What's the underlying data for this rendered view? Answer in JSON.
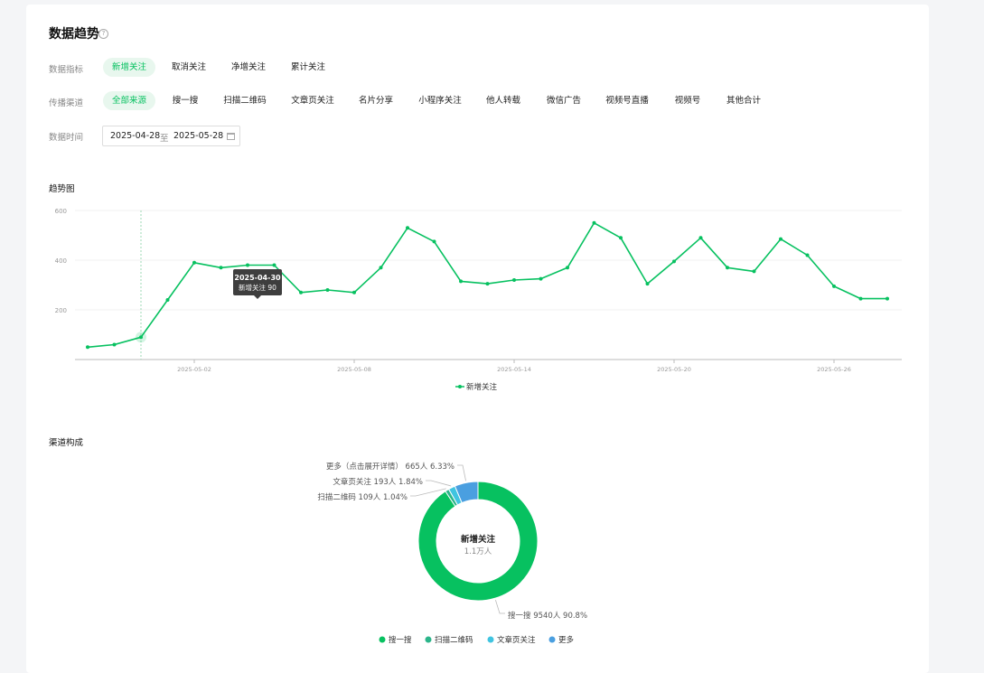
{
  "page": {
    "title": "数据趋势",
    "help_icon": "?"
  },
  "metrics": {
    "label": "数据指标",
    "options": [
      "新增关注",
      "取消关注",
      "净增关注",
      "累计关注"
    ],
    "selected": "新增关注"
  },
  "channels": {
    "label": "传播渠道",
    "options": [
      "全部来源",
      "搜一搜",
      "扫描二维码",
      "文章页关注",
      "名片分享",
      "小程序关注",
      "他人转载",
      "微信广告",
      "视频号直播",
      "视频号",
      "其他合计"
    ],
    "selected": "全部来源"
  },
  "date_range": {
    "label": "数据时间",
    "start": "2025-04-28",
    "separator": "至",
    "end": "2025-05-28"
  },
  "trend_title": "趋势图",
  "composition_title": "渠道构成",
  "tooltip": {
    "date": "2025-04-30",
    "text": "新增关注 90"
  },
  "colors": {
    "accent": "#07c160",
    "teal": "#2bb58a",
    "cyan": "#40c4e0",
    "blue": "#4a9fe0"
  },
  "chart_data": [
    {
      "type": "line",
      "series": [
        {
          "name": "新增关注",
          "values": [
            50,
            60,
            90,
            240,
            390,
            370,
            380,
            380,
            270,
            280,
            270,
            370,
            530,
            475,
            315,
            305,
            320,
            325,
            370,
            550,
            490,
            305,
            395,
            490,
            370,
            355,
            485,
            420,
            295,
            245,
            245
          ]
        }
      ],
      "x_start": "2025-04-28",
      "x_ticks": [
        "2025-05-02",
        "2025-05-08",
        "2025-05-14",
        "2025-05-20",
        "2025-05-26"
      ],
      "y_ticks": [
        200,
        400,
        600
      ],
      "ylim": [
        0,
        600
      ],
      "legend": "bottom-center",
      "grid": true
    },
    {
      "type": "pie",
      "center_title": "新增关注",
      "center_value": "1.1万人",
      "slices": [
        {
          "name": "搜一搜",
          "label": "搜一搜 9540人 90.8%",
          "value": 90.8
        },
        {
          "name": "扫描二维码",
          "label": "扫描二维码 109人 1.04%",
          "value": 1.04
        },
        {
          "name": "文章页关注",
          "label": "文章页关注 193人 1.84%",
          "value": 1.84
        },
        {
          "name": "更多",
          "label": "更多（点击展开详情） 665人 6.33%",
          "value": 6.33
        }
      ],
      "legend": "bottom-center"
    }
  ]
}
